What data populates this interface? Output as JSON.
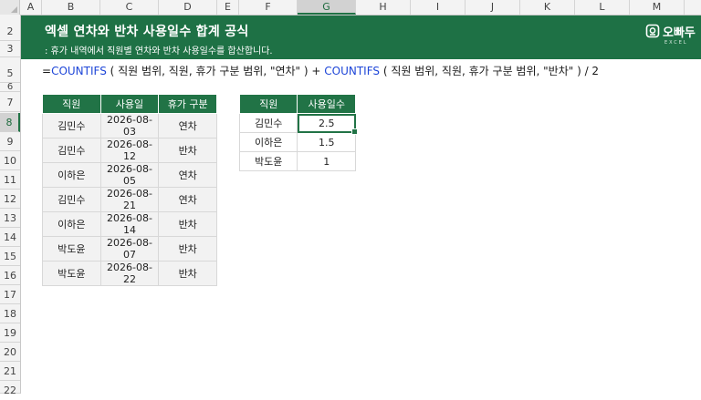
{
  "columns": [
    "A",
    "B",
    "C",
    "D",
    "E",
    "F",
    "G",
    "H",
    "I",
    "J",
    "K",
    "L",
    "M"
  ],
  "selected_column": "G",
  "rows": [
    "2",
    "3",
    "5",
    "6",
    "7",
    "8",
    "9",
    "10",
    "11",
    "12",
    "13",
    "14",
    "15",
    "16",
    "17",
    "18",
    "19",
    "20",
    "21",
    "22"
  ],
  "selected_row": "8",
  "banner": {
    "title": "엑셀 연차와 반차 사용일수 합계 공식",
    "subtitle": ": 휴가 내역에서 직원별 연차와 반차 사용일수를 합산합니다.",
    "logo_text": "오빠두",
    "logo_sub": "EXCEL"
  },
  "formula": {
    "prefix": "=",
    "fn1": "COUNTIFS",
    "args1": " ( 직원 범위, 직원, 휴가 구분 범위, \"연차\" ) + ",
    "fn2": "COUNTIFS",
    "args2": " ( 직원 범위, 직원, 휴가 구분 범위, \"반차\" ) / 2"
  },
  "leave_table": {
    "headers": [
      "직원",
      "사용일",
      "휴가 구분"
    ],
    "rows": [
      [
        "김민수",
        "2026-08-03",
        "연차"
      ],
      [
        "김민수",
        "2026-08-12",
        "반차"
      ],
      [
        "이하은",
        "2026-08-05",
        "연차"
      ],
      [
        "김민수",
        "2026-08-21",
        "연차"
      ],
      [
        "이하은",
        "2026-08-14",
        "반차"
      ],
      [
        "박도윤",
        "2026-08-07",
        "반차"
      ],
      [
        "박도윤",
        "2026-08-22",
        "반차"
      ]
    ]
  },
  "summary_table": {
    "headers": [
      "직원",
      "사용일수"
    ],
    "rows": [
      [
        "김민수",
        "2.5"
      ],
      [
        "이하은",
        "1.5"
      ],
      [
        "박도윤",
        "1"
      ]
    ]
  },
  "colors": {
    "excel_green": "#217346",
    "banner_green": "#1e7145",
    "function_blue": "#1e46d8"
  }
}
